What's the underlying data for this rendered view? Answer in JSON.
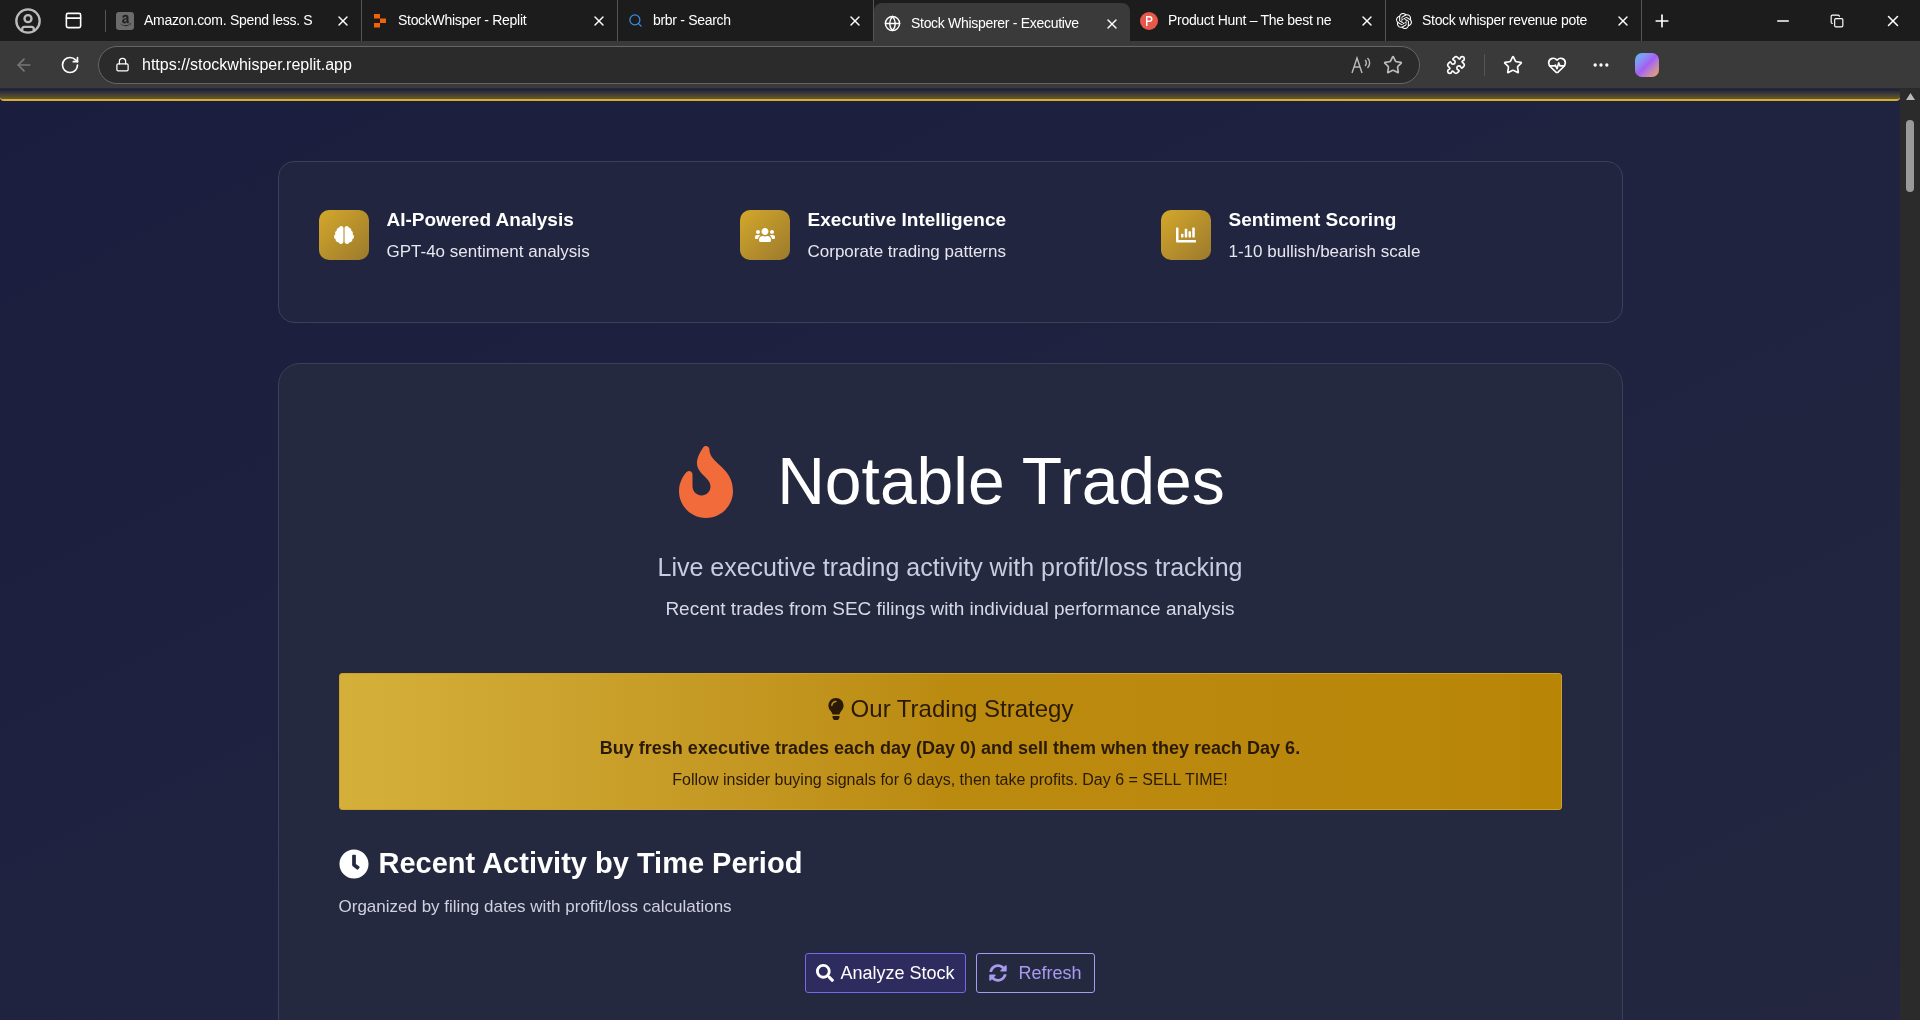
{
  "browser": {
    "tabs": [
      {
        "kind": "amazon",
        "title": "Amazon.com. Spend less. S",
        "selected": false
      },
      {
        "kind": "replit",
        "title": "StockWhisper - Replit",
        "selected": false
      },
      {
        "kind": "search",
        "title": "brbr - Search",
        "selected": false
      },
      {
        "kind": "globe",
        "title": "Stock Whisperer - Executive",
        "selected": true
      },
      {
        "kind": "producthunt",
        "title": "Product Hunt – The best ne",
        "selected": false
      },
      {
        "kind": "openai",
        "title": "Stock whisper revenue pote",
        "selected": false
      }
    ],
    "url": "https://stockwhisper.replit.app"
  },
  "features": [
    {
      "kind": "brain",
      "title": "AI-Powered Analysis",
      "subtitle": "GPT-4o sentiment analysis"
    },
    {
      "kind": "users",
      "title": "Executive Intelligence",
      "subtitle": "Corporate trading patterns"
    },
    {
      "kind": "chart",
      "title": "Sentiment Scoring",
      "subtitle": "1-10 bullish/bearish scale"
    }
  ],
  "hero": {
    "title": "Notable Trades",
    "subtitle": "Live executive trading activity with profit/loss tracking",
    "note": "Recent trades from SEC filings with individual performance analysis"
  },
  "strategy": {
    "title": "Our Trading Strategy",
    "headline": "Buy fresh executive trades each day (Day 0) and sell them when they reach Day 6.",
    "detail": "Follow insider buying signals for 6 days, then take profits. Day 6 = SELL TIME!"
  },
  "activity": {
    "title": "Recent Activity by Time Period",
    "subtitle": "Organized by filing dates with profit/loss calculations",
    "buttons": [
      {
        "kind": "analyze",
        "label": "Analyze Stock"
      },
      {
        "kind": "refresh",
        "label": "Refresh"
      }
    ]
  }
}
